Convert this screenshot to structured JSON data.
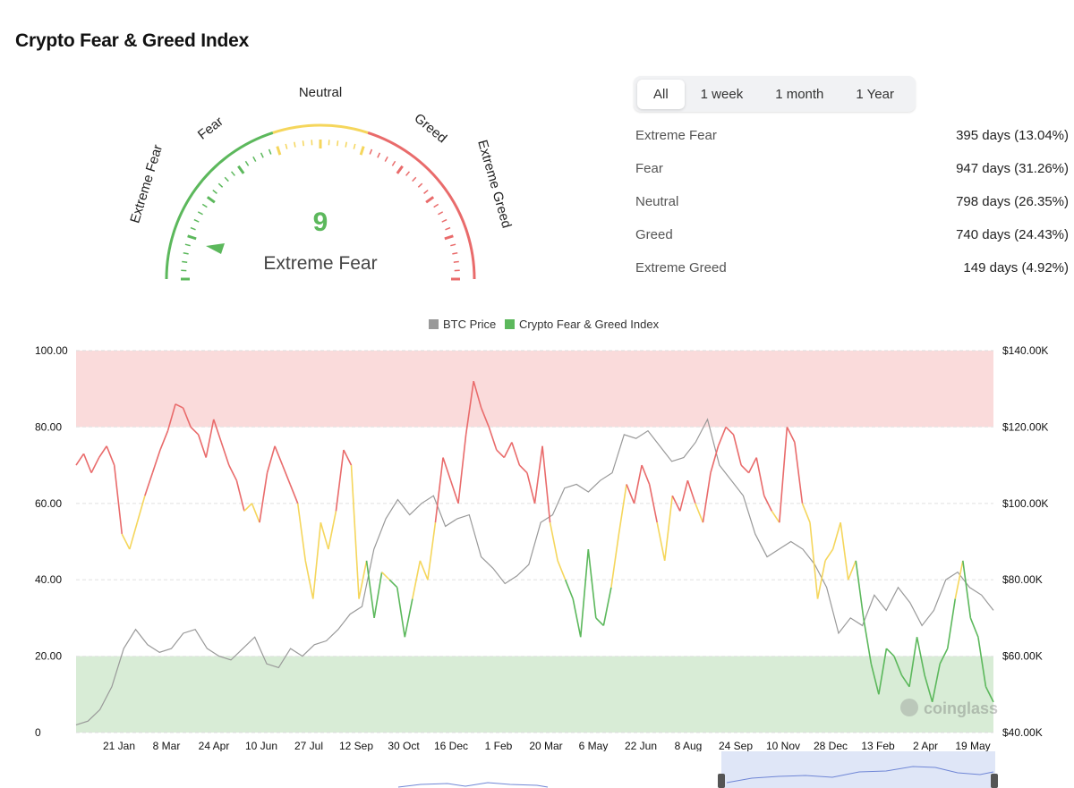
{
  "title": "Crypto Fear & Greed Index",
  "gauge": {
    "value": "9",
    "classification": "Extreme Fear",
    "labels": {
      "extreme_fear": "Extreme Fear",
      "fear": "Fear",
      "neutral": "Neutral",
      "greed": "Greed",
      "extreme_greed": "Extreme Greed"
    },
    "colors": {
      "fear": "#5cb85c",
      "neutral": "#f5d65c",
      "greed": "#e96b6b"
    }
  },
  "tabs": [
    {
      "label": "All",
      "active": true
    },
    {
      "label": "1 week",
      "active": false
    },
    {
      "label": "1 month",
      "active": false
    },
    {
      "label": "1 Year",
      "active": false
    }
  ],
  "stats": [
    {
      "label": "Extreme Fear",
      "value": "395 days (13.04%)"
    },
    {
      "label": "Fear",
      "value": "947 days (31.26%)"
    },
    {
      "label": "Neutral",
      "value": "798 days (26.35%)"
    },
    {
      "label": "Greed",
      "value": "740 days (24.43%)"
    },
    {
      "label": "Extreme Greed",
      "value": "149 days (4.92%)"
    }
  ],
  "watermark": "coinglass",
  "chart_data": {
    "type": "line",
    "legend": [
      {
        "name": "BTC Price",
        "color": "#999999"
      },
      {
        "name": "Crypto Fear & Greed Index",
        "color": "#5cb85c"
      }
    ],
    "y_left": {
      "ticks": [
        "0",
        "20.00",
        "40.00",
        "60.00",
        "80.00",
        "100.00"
      ],
      "range": [
        0,
        100
      ]
    },
    "y_right": {
      "ticks": [
        "$40.00K",
        "$60.00K",
        "$80.00K",
        "$100.00K",
        "$120.00K",
        "$140.00K"
      ],
      "range": [
        40000,
        140000
      ]
    },
    "x_ticks": [
      "21 Jan",
      "8 Mar",
      "24 Apr",
      "10 Jun",
      "27 Jul",
      "12 Sep",
      "30 Oct",
      "16 Dec",
      "1 Feb",
      "20 Mar",
      "6 May",
      "22 Jun",
      "8 Aug",
      "24 Sep",
      "10 Nov",
      "28 Dec",
      "13 Feb",
      "2 Apr",
      "19 May"
    ],
    "bands": [
      {
        "from": 80,
        "to": 100,
        "color": "#fadbdb"
      },
      {
        "from": 0,
        "to": 20,
        "color": "#d8ecd6"
      }
    ],
    "colors": {
      "extreme_fear": "#5cb85c",
      "fear": "#5cb85c",
      "neutral": "#f5d65c",
      "greed": "#e96b6b",
      "btc": "#999999"
    },
    "series": [
      {
        "name": "Crypto Fear & Greed Index",
        "values": [
          70,
          73,
          68,
          72,
          75,
          70,
          52,
          48,
          55,
          62,
          68,
          74,
          79,
          86,
          85,
          80,
          78,
          72,
          82,
          76,
          70,
          66,
          58,
          60,
          55,
          68,
          75,
          70,
          65,
          60,
          45,
          35,
          55,
          48,
          58,
          74,
          70,
          35,
          45,
          30,
          42,
          40,
          38,
          25,
          35,
          45,
          40,
          55,
          72,
          66,
          60,
          78,
          92,
          85,
          80,
          74,
          72,
          76,
          70,
          68,
          60,
          75,
          55,
          45,
          40,
          35,
          25,
          48,
          30,
          28,
          38,
          52,
          65,
          60,
          70,
          65,
          55,
          45,
          62,
          58,
          66,
          60,
          55,
          68,
          75,
          80,
          78,
          70,
          68,
          72,
          62,
          58,
          55,
          80,
          76,
          60,
          55,
          35,
          45,
          48,
          55,
          40,
          45,
          30,
          18,
          10,
          22,
          20,
          15,
          12,
          25,
          15,
          8,
          18,
          22,
          35,
          45,
          30,
          25,
          12,
          8
        ]
      },
      {
        "name": "BTC Price",
        "values": [
          42000,
          43000,
          46000,
          52000,
          62000,
          67000,
          63000,
          61000,
          62000,
          66000,
          67000,
          62000,
          60000,
          59000,
          62000,
          65000,
          58000,
          57000,
          62000,
          60000,
          63000,
          64000,
          67000,
          71000,
          73000,
          88000,
          96000,
          101000,
          97000,
          100000,
          102000,
          94000,
          96000,
          97000,
          86000,
          83000,
          79000,
          81000,
          84000,
          95000,
          97000,
          104000,
          105000,
          103000,
          106000,
          108000,
          118000,
          117000,
          119000,
          115000,
          111000,
          112000,
          116000,
          122000,
          110000,
          106000,
          102000,
          92000,
          86000,
          88000,
          90000,
          88000,
          84000,
          78000,
          66000,
          70000,
          68000,
          76000,
          72000,
          78000,
          74000,
          68000,
          72000,
          80000,
          82000,
          78000,
          76000,
          72000
        ]
      }
    ]
  }
}
